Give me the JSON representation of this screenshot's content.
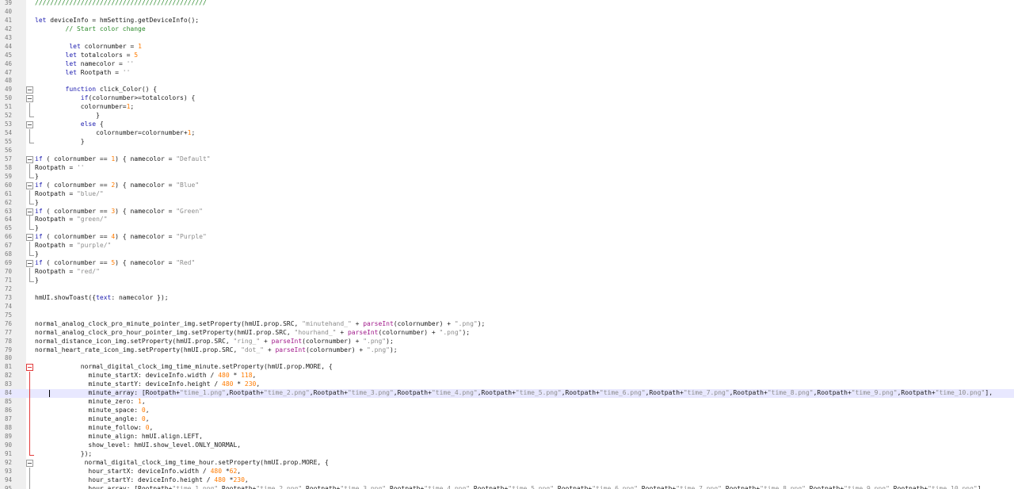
{
  "editor": {
    "first_line": 39,
    "current_line": 84,
    "lines": [
      {
        "text": "/////////////////////////////////////////////"
      },
      {
        "text": ""
      },
      {
        "text": "let deviceInfo = hmSetting.getDeviceInfo();"
      },
      {
        "text": "        // Start color change"
      },
      {
        "text": ""
      },
      {
        "text": "         let colornumber = 1"
      },
      {
        "text": "        let totalcolors = 5"
      },
      {
        "text": "        let namecolor = ''"
      },
      {
        "text": "        let Rootpath = ''"
      },
      {
        "text": ""
      },
      {
        "text": "        function click_Color() {",
        "fold": "open"
      },
      {
        "text": "            if(colornumber>=totalcolors) {",
        "fold": "open"
      },
      {
        "text": "            colornumber=1;",
        "fold": "line"
      },
      {
        "text": "                }",
        "fold": "end"
      },
      {
        "text": "            else {",
        "fold": "open"
      },
      {
        "text": "                colornumber=colornumber+1;",
        "fold": "line"
      },
      {
        "text": "            }",
        "fold": "end"
      },
      {
        "text": ""
      },
      {
        "text": "if ( colornumber == 1) { namecolor = \"Default\"",
        "fold": "open"
      },
      {
        "text": "Rootpath = ''",
        "fold": "line"
      },
      {
        "text": "}",
        "fold": "end"
      },
      {
        "text": "if ( colornumber == 2) { namecolor = \"Blue\"",
        "fold": "open"
      },
      {
        "text": "Rootpath = \"blue/\"",
        "fold": "line"
      },
      {
        "text": "}",
        "fold": "end"
      },
      {
        "text": "if ( colornumber == 3) { namecolor = \"Green\"",
        "fold": "open"
      },
      {
        "text": "Rootpath = \"green/\"",
        "fold": "line"
      },
      {
        "text": "}",
        "fold": "end"
      },
      {
        "text": "if ( colornumber == 4) { namecolor = \"Purple\"",
        "fold": "open"
      },
      {
        "text": "Rootpath = \"purple/\"",
        "fold": "line"
      },
      {
        "text": "}",
        "fold": "end"
      },
      {
        "text": "if ( colornumber == 5) { namecolor = \"Red\"",
        "fold": "open"
      },
      {
        "text": "Rootpath = \"red/\"",
        "fold": "line"
      },
      {
        "text": "}",
        "fold": "end"
      },
      {
        "text": ""
      },
      {
        "text": "hmUI.showToast({text: namecolor });"
      },
      {
        "text": ""
      },
      {
        "text": ""
      },
      {
        "text": "normal_analog_clock_pro_minute_pointer_img.setProperty(hmUI.prop.SRC, \"minutehand_\" + parseInt(colornumber) + \".png\");"
      },
      {
        "text": "normal_analog_clock_pro_hour_pointer_img.setProperty(hmUI.prop.SRC, \"hourhand_\" + parseInt(colornumber) + \".png\");"
      },
      {
        "text": "normal_distance_icon_img.setProperty(hmUI.prop.SRC, \"ring_\" + parseInt(colornumber) + \".png\");"
      },
      {
        "text": "normal_heart_rate_icon_img.setProperty(hmUI.prop.SRC, \"dot_\" + parseInt(colornumber) + \".png\");"
      },
      {
        "text": ""
      },
      {
        "text": "            normal_digital_clock_img_time_minute.setProperty(hmUI.prop.MORE, {",
        "fold": "open-red"
      },
      {
        "text": "              minute_startX: deviceInfo.width / 480 * 118,",
        "fold": "line-red"
      },
      {
        "text": "              minute_startY: deviceInfo.height / 480 * 230,",
        "fold": "line-red"
      },
      {
        "text": "              minute_array: [Rootpath+\"time_1.png\",Rootpath+\"time_2.png\",Rootpath+\"time_3.png\",Rootpath+\"time_4.png\",Rootpath+\"time_5.png\",Rootpath+\"time_6.png\",Rootpath+\"time_7.png\",Rootpath+\"time_8.png\",Rootpath+\"time_9.png\",Rootpath+\"time_10.png\"],",
        "fold": "line-red"
      },
      {
        "text": "              minute_zero: 1,",
        "fold": "line-red"
      },
      {
        "text": "              minute_space: 0,",
        "fold": "line-red"
      },
      {
        "text": "              minute_angle: 0,",
        "fold": "line-red"
      },
      {
        "text": "              minute_follow: 0,",
        "fold": "line-red"
      },
      {
        "text": "              minute_align: hmUI.align.LEFT,",
        "fold": "line-red"
      },
      {
        "text": "              show_level: hmUI.show_level.ONLY_NORMAL,",
        "fold": "line-red"
      },
      {
        "text": "            });",
        "fold": "end-red"
      },
      {
        "text": "             normal_digital_clock_img_time_hour.setProperty(hmUI.prop.MORE, {",
        "fold": "open"
      },
      {
        "text": "              hour_startX: deviceInfo.width / 480 *62,",
        "fold": "line"
      },
      {
        "text": "              hour_startY: deviceInfo.height / 480 *230,",
        "fold": "line"
      },
      {
        "text": "              hour_array: [Rootpath+\"time_1.png\",Rootpath+\"time_2.png\",Rootpath+\"time_3.png\",Rootpath+\"time_4.png\",Rootpath+\"time_5.png\",Rootpath+\"time_6.png\",Rootpath+\"time_7.png\",Rootpath+\"time_8.png\",Rootpath+\"time_9.png\",Rootpath+\"time_10.png\"],",
        "fold": "line"
      }
    ]
  },
  "colors": {
    "keyword": "#2020b0",
    "function": "#a0198a",
    "string": "#8c8c8c",
    "number": "#ff7b00",
    "comment": "#2e8b2e",
    "current_line": "#e8e8ff",
    "fold_marker_active": "#e23b3b"
  }
}
